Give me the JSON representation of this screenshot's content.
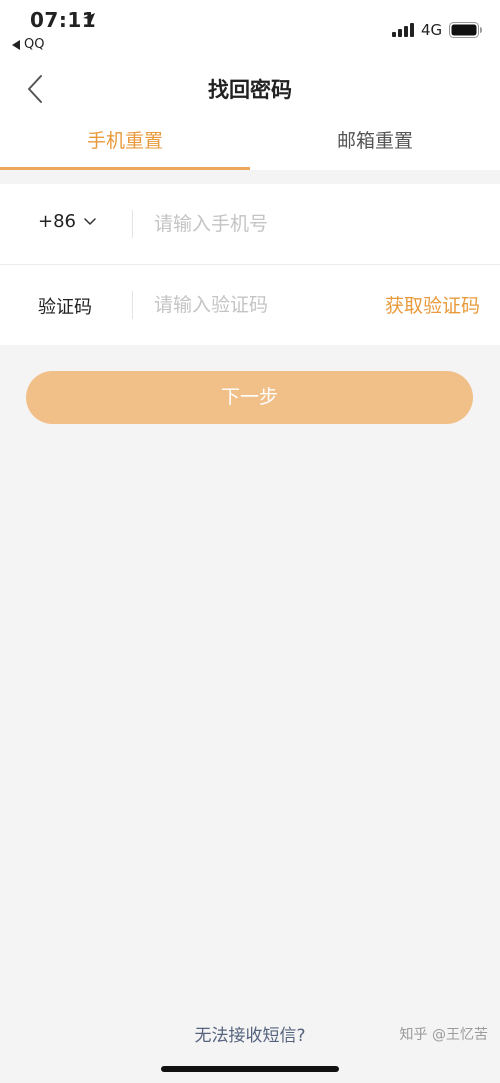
{
  "status_bar": {
    "time": "07:11",
    "back_app": "QQ",
    "network": "4G"
  },
  "nav": {
    "title": "找回密码"
  },
  "tabs": [
    {
      "label": "手机重置",
      "active": true
    },
    {
      "label": "邮箱重置",
      "active": false
    }
  ],
  "form": {
    "country_code": "+86",
    "phone_placeholder": "请输入手机号",
    "phone_value": "",
    "code_label": "验证码",
    "code_placeholder": "请输入验证码",
    "code_value": "",
    "get_code_label": "获取验证码"
  },
  "next_label": "下一步",
  "cannot_receive_label": "无法接收短信?",
  "watermark": "知乎 @王忆苦",
  "colors": {
    "accent": "#e89a3c",
    "button_bg": "#f1bf88",
    "page_bg": "#f4f4f4"
  }
}
